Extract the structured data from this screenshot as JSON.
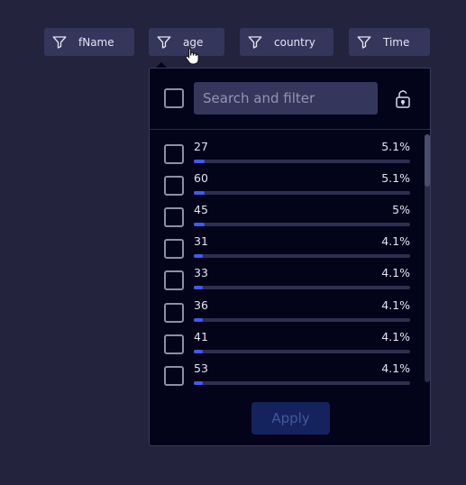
{
  "filters": [
    {
      "label": "fName",
      "icon": "filter-icon"
    },
    {
      "label": "age",
      "icon": "filter-icon"
    },
    {
      "label": "country",
      "icon": "filter-icon"
    },
    {
      "label": "Time",
      "icon": "filter-icon"
    }
  ],
  "dropdown": {
    "search_placeholder": "Search and filter",
    "lock_icon": "unlock-icon",
    "apply_label": "Apply",
    "items": [
      {
        "value": "27",
        "percent": "5.1%",
        "fraction": 0.051
      },
      {
        "value": "60",
        "percent": "5.1%",
        "fraction": 0.051
      },
      {
        "value": "45",
        "percent": "5%",
        "fraction": 0.05
      },
      {
        "value": "31",
        "percent": "4.1%",
        "fraction": 0.041
      },
      {
        "value": "33",
        "percent": "4.1%",
        "fraction": 0.041
      },
      {
        "value": "36",
        "percent": "4.1%",
        "fraction": 0.041
      },
      {
        "value": "41",
        "percent": "4.1%",
        "fraction": 0.041
      },
      {
        "value": "53",
        "percent": "4.1%",
        "fraction": 0.041
      }
    ]
  },
  "colors": {
    "background": "#23233e",
    "chip": "#35365c",
    "panel": "#03031a",
    "bar_fill": "#3d5bf5",
    "apply_bg": "#14235e"
  }
}
